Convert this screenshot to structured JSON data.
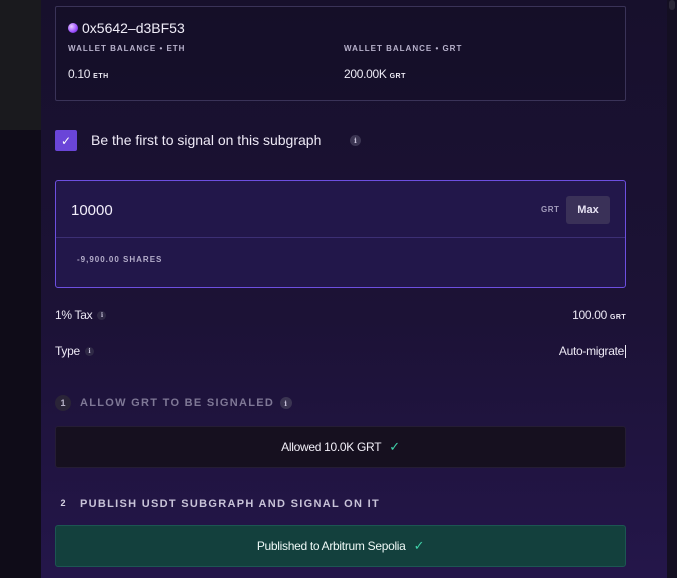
{
  "wallet": {
    "address": "0x5642–d3BF53",
    "eth_label": "WALLET BALANCE • ETH",
    "eth_value": "0.10",
    "eth_unit": "ETH",
    "grt_label": "WALLET BALANCE • GRT",
    "grt_value": "200.00K",
    "grt_unit": "GRT"
  },
  "signal_first": {
    "label": "Be the first to signal on this subgraph",
    "checked": true
  },
  "amount": {
    "value": "10000",
    "unit": "GRT",
    "max_label": "Max",
    "shares": "-9,900.00 SHARES"
  },
  "tax": {
    "label": "1% Tax",
    "value": "100.00",
    "unit": "GRT"
  },
  "type": {
    "label": "Type",
    "value": "Auto-migrate"
  },
  "steps": [
    {
      "number": "1",
      "title": "ALLOW GRT TO BE SIGNALED",
      "status": "Allowed 10.0K GRT",
      "state": "done"
    },
    {
      "number": "2",
      "title": "PUBLISH USDT SUBGRAPH AND SIGNAL ON IT",
      "status": "Published to Arbitrum Sepolia",
      "state": "done"
    }
  ],
  "colors": {
    "accent": "#6a45d8",
    "success": "#3fd0a8",
    "published_bg": "#13403d"
  }
}
